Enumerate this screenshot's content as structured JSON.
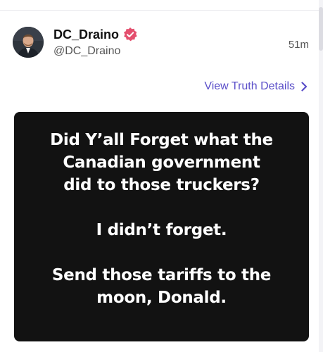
{
  "post": {
    "author": {
      "display_name": "DC_Draino",
      "handle": "@DC_Draino",
      "verified": true,
      "verified_badge_color": "#e44f6e"
    },
    "timestamp": "51m",
    "details_link": {
      "label": "View Truth Details",
      "icon": "chevron-right-icon",
      "color": "#5b4fc9"
    },
    "image_text": {
      "paragraph_1": [
        "Did Y’all Forget what the",
        "Canadian government",
        "did to those truckers?"
      ],
      "paragraph_2": [
        "I didn’t forget."
      ],
      "paragraph_3": [
        "Send those tariffs to the",
        "moon, Donald."
      ],
      "background_color": "#121212",
      "text_color": "#ffffff"
    }
  }
}
